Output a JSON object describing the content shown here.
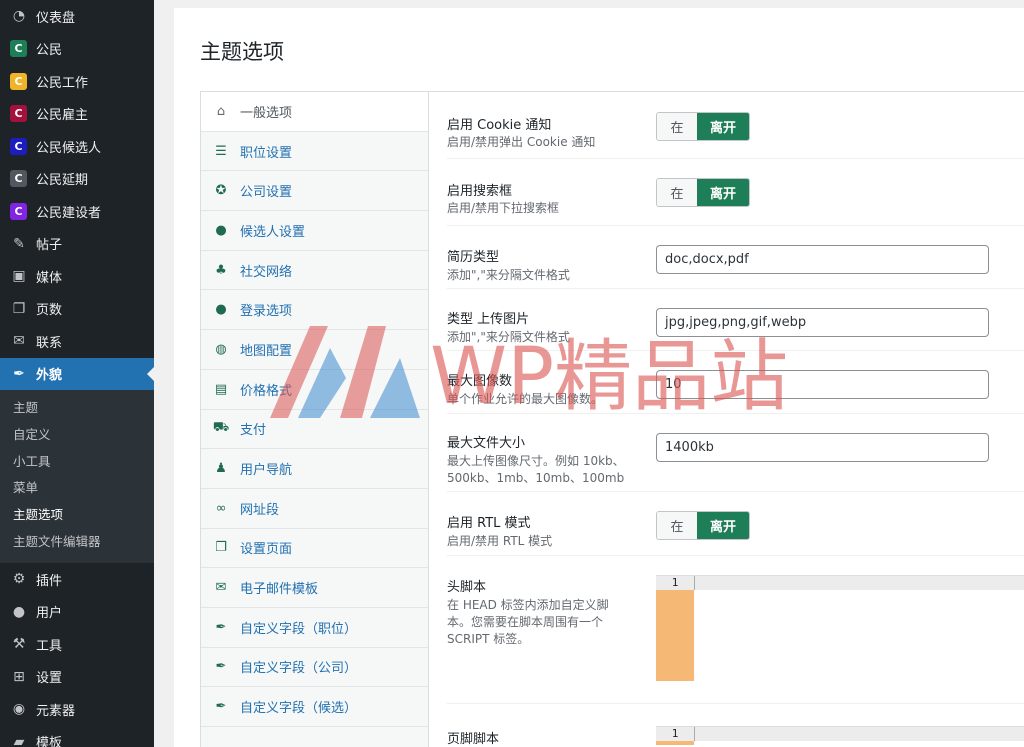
{
  "sidebar": {
    "items": [
      {
        "label": "仪表盘",
        "icon": "dashboard-icon"
      },
      {
        "label": "公民",
        "icon": "c-green-badge"
      },
      {
        "label": "公民工作",
        "icon": "c-yellow-badge"
      },
      {
        "label": "公民雇主",
        "icon": "c-crimson-badge"
      },
      {
        "label": "公民候选人",
        "icon": "c-blue-badge"
      },
      {
        "label": "公民延期",
        "icon": "c-gray-badge"
      },
      {
        "label": "公民建设者",
        "icon": "c-purple-badge"
      },
      {
        "label": "帖子",
        "icon": "pin-icon"
      },
      {
        "label": "媒体",
        "icon": "media-icon"
      },
      {
        "label": "页数",
        "icon": "pages-icon"
      },
      {
        "label": "联系",
        "icon": "mail-icon"
      },
      {
        "label": "外貌",
        "icon": "brush-icon"
      }
    ],
    "submenu": [
      "主题",
      "自定义",
      "小工具",
      "菜单",
      "主题选项",
      "主题文件编辑器"
    ],
    "items_after": [
      {
        "label": "插件",
        "icon": "plugin-icon"
      },
      {
        "label": "用户",
        "icon": "user-icon"
      },
      {
        "label": "工具",
        "icon": "wrench-icon"
      },
      {
        "label": "设置",
        "icon": "settings-icon"
      },
      {
        "label": "元素器",
        "icon": "elementor-icon"
      },
      {
        "label": "模板",
        "icon": "folder-icon"
      }
    ],
    "badge_colors": {
      "green": "#1e7e57",
      "yellow": "#f0b429",
      "crimson": "#a3123d",
      "blue": "#1d1dbf",
      "gray": "#50575e",
      "purple": "#8224e3"
    }
  },
  "page": {
    "title": "主题选项"
  },
  "tabs": [
    {
      "label": "一般选项",
      "icon": "home-icon"
    },
    {
      "label": "职位设置",
      "icon": "list-icon"
    },
    {
      "label": "公司设置",
      "icon": "award-icon"
    },
    {
      "label": "候选人设置",
      "icon": "user-icon"
    },
    {
      "label": "社交网络",
      "icon": "network-icon"
    },
    {
      "label": "登录选项",
      "icon": "user-icon"
    },
    {
      "label": "地图配置",
      "icon": "globe-icon"
    },
    {
      "label": "价格格式",
      "icon": "price-icon"
    },
    {
      "label": "支付",
      "icon": "cart-icon"
    },
    {
      "label": "用户导航",
      "icon": "group-icon"
    },
    {
      "label": "网址段",
      "icon": "link-icon"
    },
    {
      "label": "设置页面",
      "icon": "copy-icon"
    },
    {
      "label": "电子邮件模板",
      "icon": "email-icon"
    },
    {
      "label": "自定义字段（职位）",
      "icon": "brush-icon"
    },
    {
      "label": "自定义字段（公司）",
      "icon": "brush-icon"
    },
    {
      "label": "自定义字段（候选）",
      "icon": "brush-icon"
    }
  ],
  "settings": {
    "cookie": {
      "label": "启用 Cookie 通知",
      "desc": "启用/禁用弹出 Cookie 通知",
      "on": "在",
      "off": "离开"
    },
    "search": {
      "label": "启用搜索框",
      "desc": "启用/禁用下拉搜索框",
      "on": "在",
      "off": "离开"
    },
    "resume_type": {
      "label": "简历类型",
      "desc": "添加\",\"来分隔文件格式",
      "value": "doc,docx,pdf"
    },
    "image_type": {
      "label": "类型 上传图片",
      "desc": "添加\",\"来分隔文件格式",
      "value": "jpg,jpeg,png,gif,webp"
    },
    "max_images": {
      "label": "最大图像数",
      "desc": "单个作业允许的最大图像数。",
      "value": "10"
    },
    "max_file": {
      "label": "最大文件大小",
      "desc": "最大上传图像尺寸。例如 10kb、500kb、1mb、10mb、100mb",
      "value": "1400kb"
    },
    "rtl": {
      "label": "启用 RTL 模式",
      "desc": "启用/禁用 RTL 模式",
      "on": "在",
      "off": "离开"
    },
    "header_script": {
      "label": "头脚本",
      "desc": "在 HEAD 标签内添加自定义脚本。您需要在脚本周围有一个 SCRIPT 标签。",
      "line": "1"
    },
    "footer_script": {
      "label": "页脚脚本",
      "line": "1"
    }
  },
  "watermark": {
    "text": "WP精品站"
  }
}
